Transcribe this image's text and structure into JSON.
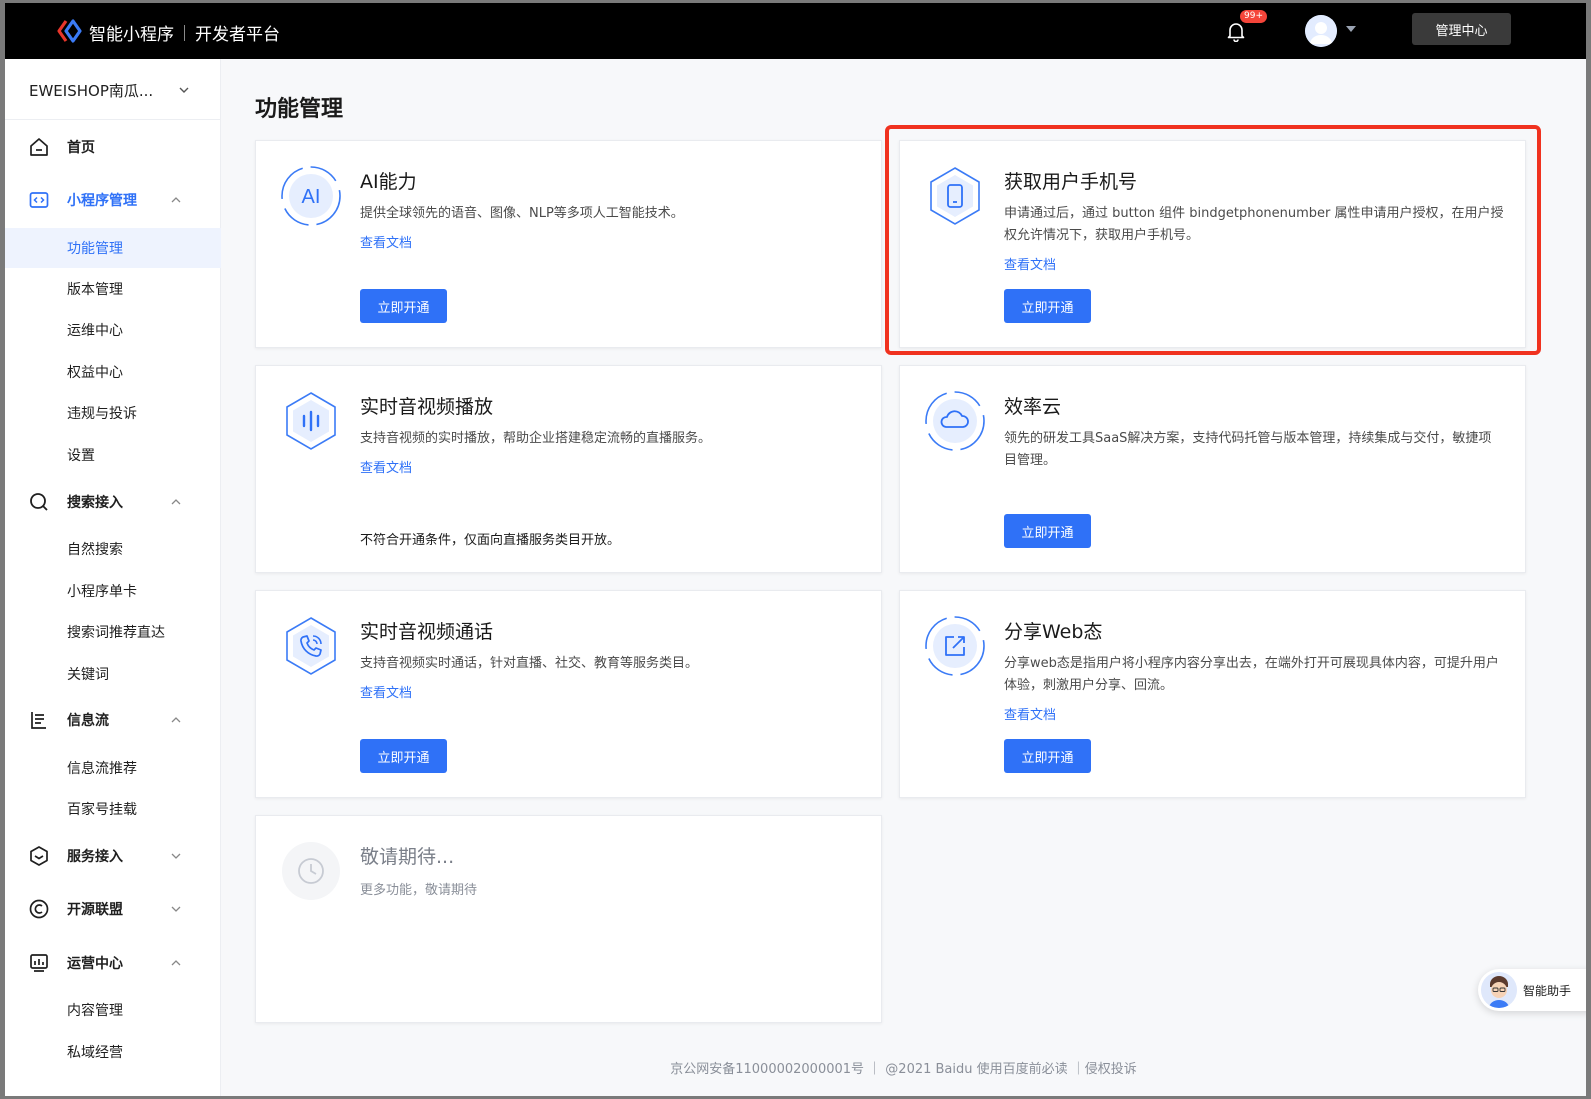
{
  "topbar": {
    "brand_name": "智能小程序",
    "brand_sub": "开发者平台",
    "notification_count": "99+",
    "admin_button": "管理中心"
  },
  "sidebar": {
    "app_name": "EWEISHOP南瓜...",
    "home": "首页",
    "groups": {
      "miniprogram": {
        "label": "小程序管理",
        "items": [
          "功能管理",
          "版本管理",
          "运维中心",
          "权益中心",
          "违规与投诉",
          "设置"
        ]
      },
      "search": {
        "label": "搜索接入",
        "items": [
          "自然搜索",
          "小程序单卡",
          "搜索词推荐直达",
          "关键词"
        ]
      },
      "feed": {
        "label": "信息流",
        "items": [
          "信息流推荐",
          "百家号挂载"
        ]
      },
      "service": {
        "label": "服务接入"
      },
      "opensource": {
        "label": "开源联盟"
      },
      "operation": {
        "label": "运营中心",
        "items": [
          "内容管理",
          "私域经营"
        ]
      }
    }
  },
  "page": {
    "title": "功能管理"
  },
  "cards": {
    "ai": {
      "title": "AI能力",
      "icon_text": "AI",
      "desc": "提供全球领先的语音、图像、NLP等多项人工智能技术。",
      "link": "查看文档",
      "button": "立即开通"
    },
    "phone": {
      "title": "获取用户手机号",
      "desc": "申请通过后，通过 button 组件 bindgetphonenumber 属性申请用户授权，在用户授权允许情况下，获取用户手机号。",
      "link": "查看文档",
      "button": "立即开通"
    },
    "live": {
      "title": "实时音视频播放",
      "desc": "支持音视频的实时播放，帮助企业搭建稳定流畅的直播服务。",
      "link": "查看文档",
      "note": "不符合开通条件，仅面向直播服务类目开放。"
    },
    "cloud": {
      "title": "效率云",
      "desc": "领先的研发工具SaaS解决方案，支持代码托管与版本管理，持续集成与交付，敏捷项目管理。",
      "button": "立即开通"
    },
    "call": {
      "title": "实时音视频通话",
      "desc": "支持音视频实时通话，针对直播、社交、教育等服务类目。",
      "link": "查看文档",
      "button": "立即开通"
    },
    "share": {
      "title": "分享Web态",
      "desc": "分享web态是指用户将小程序内容分享出去，在端外打开可展现具体内容，可提升用户体验，刺激用户分享、回流。",
      "link": "查看文档",
      "button": "立即开通"
    },
    "soon": {
      "title": "敬请期待...",
      "desc": "更多功能，敬请期待"
    }
  },
  "footer": {
    "text": "京公网安备11000002000001号 ｜ @2021 Baidu 使用百度前必读 ｜侵权投诉"
  },
  "assistant": {
    "label": "智能助手"
  },
  "colors": {
    "accent": "#2f71f7",
    "highlight": "#f0321f",
    "topbar": "#000000"
  }
}
